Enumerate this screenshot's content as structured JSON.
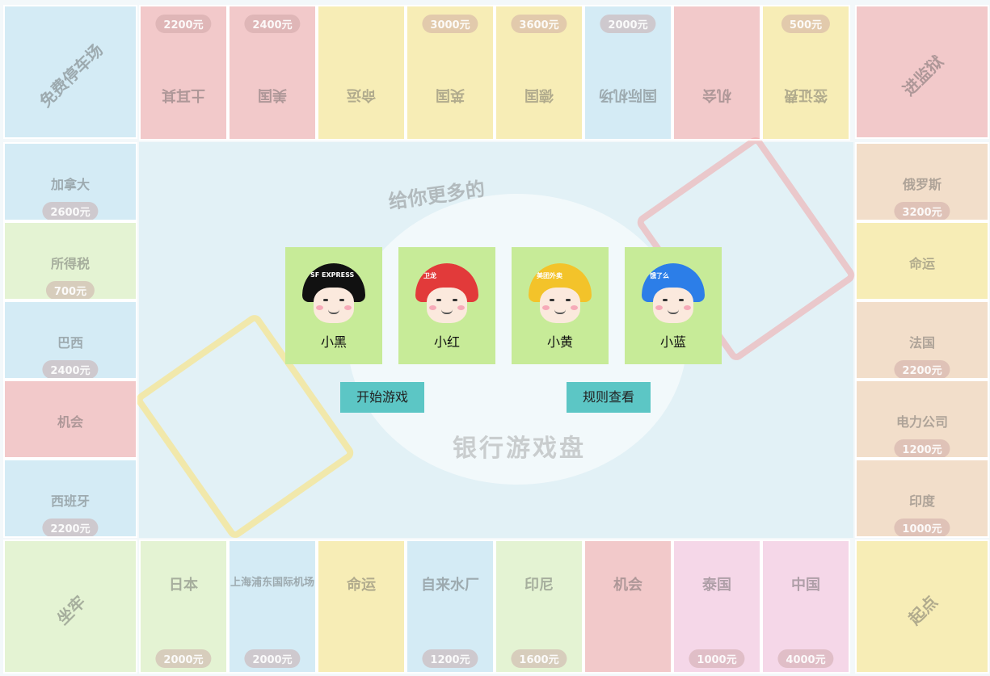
{
  "players": [
    {
      "name": "小黑",
      "helmet_color": "#111111",
      "helmet_text": "SF EXPRESS"
    },
    {
      "name": "小红",
      "helmet_color": "#e23a3a",
      "helmet_text": "卫龙"
    },
    {
      "name": "小黄",
      "helmet_color": "#f3c32a",
      "helmet_text": "美团外卖"
    },
    {
      "name": "小蓝",
      "helmet_color": "#2c7ee8",
      "helmet_text": "饿了么"
    }
  ],
  "buttons": {
    "start": "开始游戏",
    "rules": "规则查看"
  },
  "board": {
    "top": [
      {
        "name": "土耳其",
        "price": "2200元",
        "color": "#f2a0a0"
      },
      {
        "name": "美国",
        "price": "2400元",
        "color": "#f2a0a0"
      },
      {
        "name": "命运",
        "price": "",
        "color": "#fbe27a"
      },
      {
        "name": "英国",
        "price": "3000元",
        "color": "#fbe27a"
      },
      {
        "name": "德国",
        "price": "3600元",
        "color": "#fbe27a"
      },
      {
        "name": "国际机场",
        "price": "2000元",
        "color": "#b9dff0"
      },
      {
        "name": "机会",
        "price": "",
        "color": "#f2a0a0"
      },
      {
        "name": "签证费",
        "price": "500元",
        "color": "#fbe27a"
      }
    ],
    "bottom": [
      {
        "name": "日本",
        "price": "2000元",
        "color": "#d8eeb0"
      },
      {
        "name": "上海浦东国际机场",
        "price": "2000元",
        "color": "#b9dff0"
      },
      {
        "name": "命运",
        "price": "",
        "color": "#fbe27a"
      },
      {
        "name": "自来水厂",
        "price": "1200元",
        "color": "#b9dff0"
      },
      {
        "name": "印尼",
        "price": "1600元",
        "color": "#d8eeb0"
      },
      {
        "name": "机会",
        "price": "",
        "color": "#f2a0a0"
      },
      {
        "name": "泰国",
        "price": "1000元",
        "color": "#f7b9d8"
      },
      {
        "name": "中国",
        "price": "4000元",
        "color": "#f7b9d8"
      }
    ],
    "left": [
      {
        "name": "加拿大",
        "price": "2600元",
        "color": "#b9dff0"
      },
      {
        "name": "所得税",
        "price": "700元",
        "color": "#d8eeb0"
      },
      {
        "name": "巴西",
        "price": "2400元",
        "color": "#b9dff0"
      },
      {
        "name": "机会",
        "price": "",
        "color": "#f2a0a0"
      },
      {
        "name": "西班牙",
        "price": "2200元",
        "color": "#b9dff0"
      }
    ],
    "right": [
      {
        "name": "俄罗斯",
        "price": "3200元",
        "color": "#f2c7a0"
      },
      {
        "name": "命运",
        "price": "",
        "color": "#fbe27a"
      },
      {
        "name": "法国",
        "price": "2200元",
        "color": "#f2c7a0"
      },
      {
        "name": "电力公司",
        "price": "1200元",
        "color": "#f2c7a0"
      },
      {
        "name": "印度",
        "price": "1000元",
        "color": "#f2c7a0"
      }
    ],
    "corners": {
      "top_left": "免费停车场",
      "top_right": "进监狱",
      "bottom_left": "坐牢",
      "bottom_right": "起点"
    },
    "center_title": "给你更多的",
    "center_subtitle": "银行游戏盘"
  }
}
